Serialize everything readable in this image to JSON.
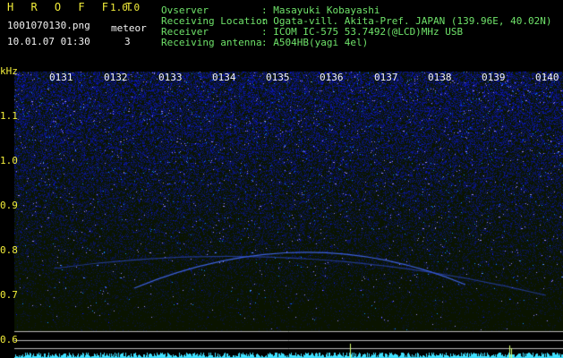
{
  "header": {
    "app_title": "H R O F F T",
    "app_version": "1.0.0",
    "filename": "1001070130.png",
    "datetime": "10.01.07 01:30",
    "meteor_label": "meteor",
    "meteor_count": "3",
    "info": [
      {
        "label": "Ovserver",
        "value": ": Masayuki Kobayashi"
      },
      {
        "label": "Receiving Location",
        "value": ": Ogata-vill. Akita-Pref. JAPAN (139.96E, 40.02N)"
      },
      {
        "label": "Receiver",
        "value": ": ICOM IC-575 53.7492(@LCD)MHz USB"
      },
      {
        "label": "Receiving antenna",
        "value": ": A504HB(yagi 4el)"
      }
    ]
  },
  "axis": {
    "unit": "kHz",
    "y_labels": [
      "1.1",
      "1.0",
      "0.9",
      "0.8",
      "0.7",
      "0.6"
    ],
    "x_labels": [
      "0131",
      "0132",
      "0133",
      "0134",
      "0135",
      "0136",
      "0137",
      "0138",
      "0139",
      "0140"
    ]
  },
  "colors": {
    "background": "#000000",
    "label_yellow": "#f3ee3a",
    "label_green": "#6fe36a",
    "noise": "#2d3cff",
    "hline": "#b9b9b9",
    "bar": "#3fe0ff"
  }
}
